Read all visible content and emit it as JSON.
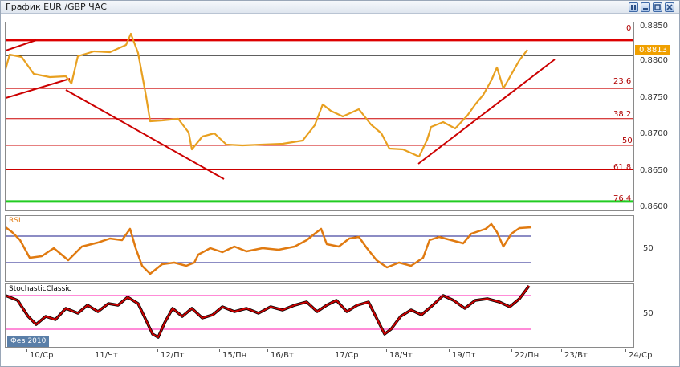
{
  "window": {
    "title": "График EUR /GBP  ЧАС",
    "buttons": [
      "tile-icon",
      "restore-icon",
      "maximize-icon",
      "close-icon"
    ]
  },
  "price_axis": {
    "labels": [
      "0.8850",
      "0.8800",
      "0.8750",
      "0.8700",
      "0.8650",
      "0.8600"
    ],
    "current_price": "0.8813",
    "current_price_color": "#f0a000"
  },
  "fibonacci": {
    "levels": [
      "0",
      "23.6",
      "38.2",
      "50",
      "61.8",
      "76.4"
    ],
    "line_color": "#cc0000",
    "top_line_color": "#dd0000",
    "bottom_line_color": "#22cc22"
  },
  "indicators": {
    "rsi": {
      "name": "RSI",
      "level_label": "50",
      "label_color": "#e07a10"
    },
    "stochastic": {
      "name": "StochasticClassic",
      "level_label": "50",
      "label_color": "#000000"
    }
  },
  "time_axis": {
    "period_badge": "Фев 2010",
    "dates": [
      "10/Ср",
      "11/Чт",
      "12/Пт",
      "15/Пн",
      "16/Вт",
      "17/Ср",
      "18/Чт",
      "19/Пт",
      "22/Пн",
      "23/Вт",
      "24/Ср"
    ]
  },
  "chart_data": {
    "type": "line",
    "symbol": "EUR/GBP",
    "timeframe": "ЧАС",
    "ylim": [
      0.859,
      0.886
    ],
    "x": [
      "10/Ср",
      "11/Чт",
      "12/Пт",
      "15/Пн",
      "16/Вт",
      "17/Ср",
      "18/Чт",
      "19/Пт",
      "22/Пн"
    ],
    "series": [
      {
        "values": [
          0.8805,
          0.8815,
          0.873,
          0.869,
          0.8685,
          0.873,
          0.8665,
          0.8745,
          0.8813
        ]
      }
    ],
    "last_price": 0.8813,
    "fib_levels": [
      {
        "label": "0",
        "value": 0.8835
      },
      {
        "label": "23.6",
        "value": 0.8766
      },
      {
        "label": "38.2",
        "value": 0.8723
      },
      {
        "label": "50",
        "value": 0.8685
      },
      {
        "label": "61.8",
        "value": 0.865
      },
      {
        "label": "76.4",
        "value": 0.8605
      }
    ]
  }
}
